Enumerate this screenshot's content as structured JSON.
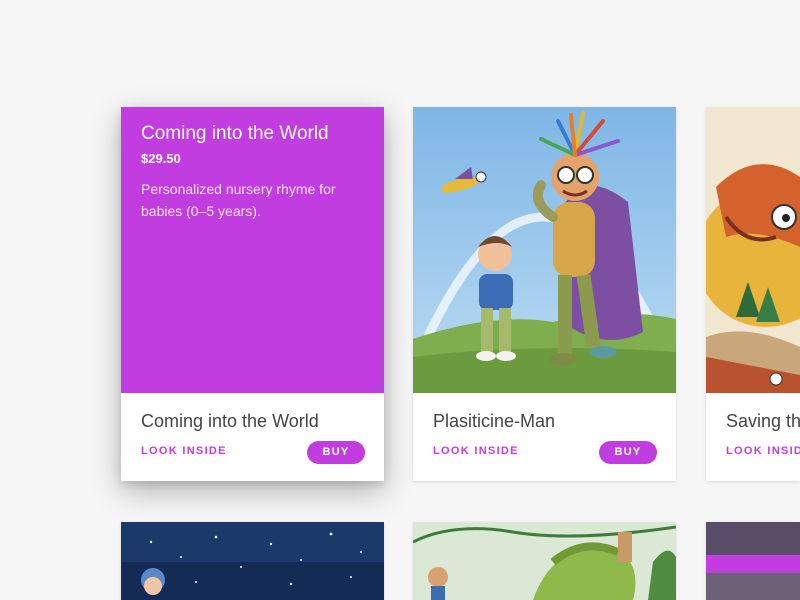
{
  "colors": {
    "accent": "#c23de0",
    "background": "#f6f6f7",
    "title_text": "#444444"
  },
  "featured": {
    "title": "Coming into the World",
    "price": "$29.50",
    "description": "Personalized nursery rhyme for babies (0–5 years)."
  },
  "cards": [
    {
      "title": "Coming into the World",
      "look_label": "LOOK INSIDE",
      "buy_label": "BUY",
      "cover": "purple-overlay"
    },
    {
      "title": "Plasiticine-Man",
      "look_label": "LOOK INSIDE",
      "buy_label": "BUY",
      "cover": "plasticine-hero-illustration"
    },
    {
      "title": "Saving th",
      "look_label": "LOOK INSID",
      "cover": "dragon-storybook-illustration"
    }
  ],
  "bottom_row": [
    {
      "cover": "night-sky-illustration"
    },
    {
      "cover": "jungle-vine-illustration"
    },
    {
      "cover": "purple-banner-illustration"
    }
  ]
}
